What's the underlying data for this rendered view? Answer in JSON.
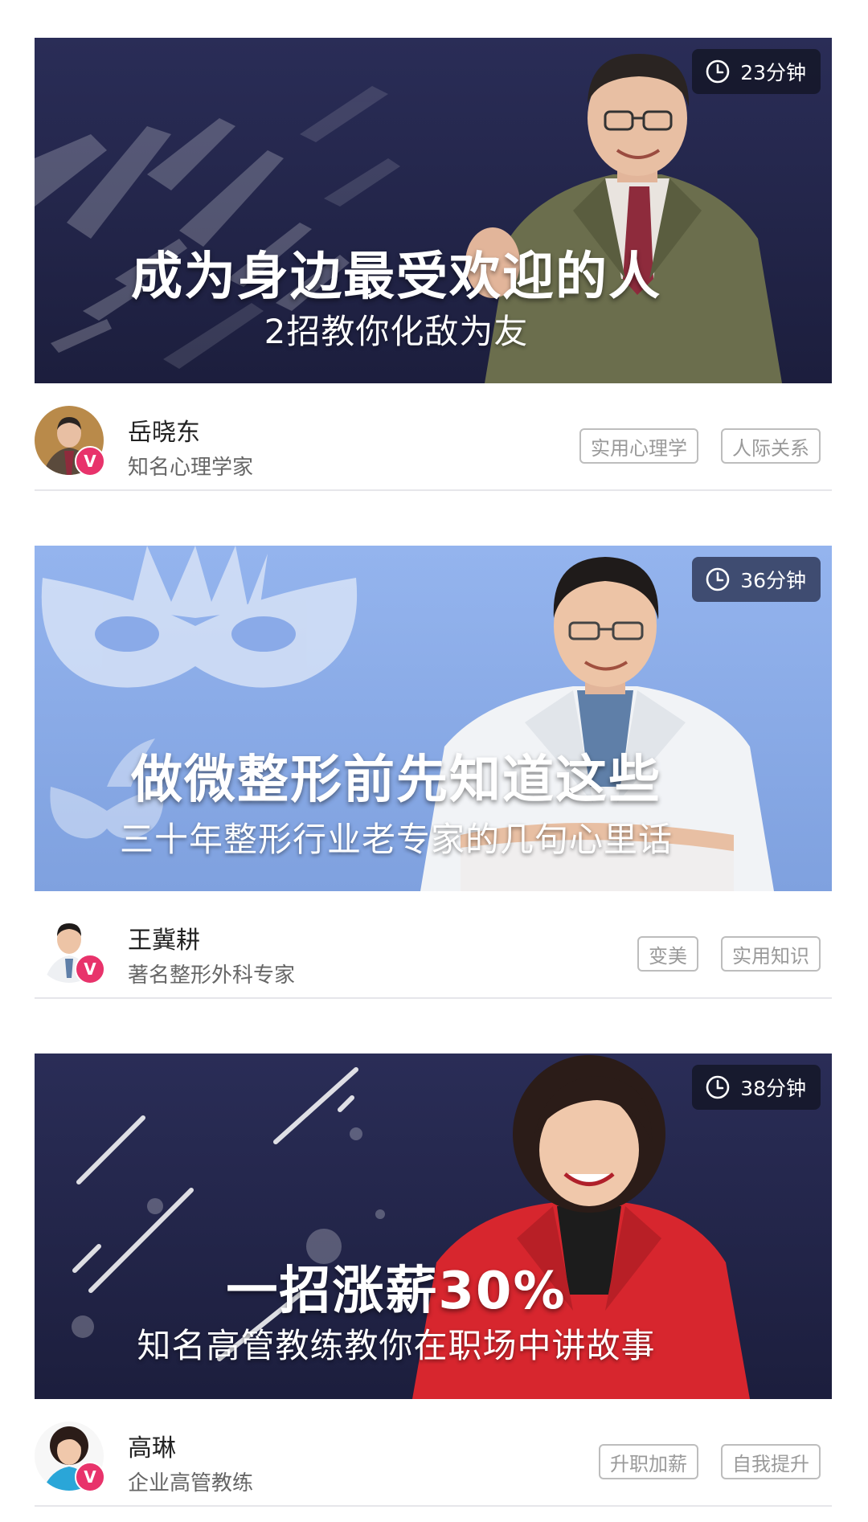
{
  "courses": [
    {
      "duration": "23分钟",
      "headline": "成为身边最受欢迎的人",
      "subline": "2招教你化敌为友",
      "author": {
        "name": "岳晓东",
        "title": "知名心理学家"
      },
      "tags": [
        "实用心理学",
        "人际关系"
      ],
      "verified_badge": "V"
    },
    {
      "duration": "36分钟",
      "headline": "做微整形前先知道这些",
      "subline": "三十年整形行业老专家的几句心里话",
      "author": {
        "name": "王冀耕",
        "title": "著名整形外科专家"
      },
      "tags": [
        "变美",
        "实用知识"
      ],
      "verified_badge": "V"
    },
    {
      "duration": "38分钟",
      "headline": "一招涨薪30%",
      "subline": "知名高管教练教你在职场中讲故事",
      "author": {
        "name": "高琳",
        "title": "企业高管教练"
      },
      "tags": [
        "升职加薪",
        "自我提升"
      ],
      "verified_badge": "V"
    }
  ],
  "colors": {
    "badge": "#e8336b",
    "tag_border": "#bdbdbd",
    "dark_banner": "#23264a",
    "light_banner": "#8aaae8"
  },
  "icons": {
    "duration": "clock-icon",
    "verified": "verified-v-badge"
  }
}
